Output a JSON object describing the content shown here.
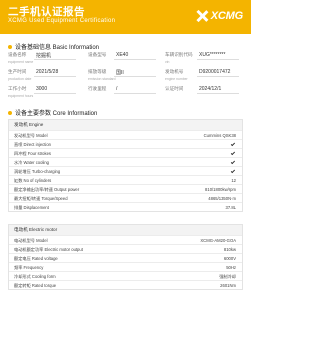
{
  "header": {
    "title_cn": "二手机认证报告",
    "title_en": "XCMG Used Equipment Certification",
    "logo": "XCMG"
  },
  "basic_info": {
    "section_title": "设备基础信息 Basic Information",
    "rows": [
      [
        {
          "label": "设备名称",
          "en": "equipment name",
          "value": "挖掘机"
        },
        {
          "label": "设备型号",
          "en": "",
          "value": "XE40"
        },
        {
          "label": "车辆识别代码",
          "en": "vin",
          "value": "XUG********"
        }
      ],
      [
        {
          "label": "生产时间",
          "en": "production date",
          "value": "2021/5/28"
        },
        {
          "label": "排放等级",
          "en": "emission standard",
          "value": "国II"
        },
        {
          "label": "发动机号",
          "en": "engine number",
          "value": "D9200017472"
        }
      ],
      [
        {
          "label": "工作小时",
          "en": "equipment hours",
          "value": "3000"
        },
        {
          "label": "行驶里程",
          "en": "",
          "value": "/"
        },
        {
          "label": "认证时间",
          "en": "",
          "value": "2024/12/1"
        }
      ]
    ]
  },
  "core_info": {
    "section_title": "设备主要参数 Core Information",
    "engine": {
      "head": "发动机 Engine",
      "rows": [
        {
          "label": "发动机型号 Model",
          "value": "Cummins QSK38",
          "check": false
        },
        {
          "label": "直喷 Direct injection",
          "value": "",
          "check": true
        },
        {
          "label": "四冲程 Four strokes",
          "value": "",
          "check": true
        },
        {
          "label": "水冷 Water cooling",
          "value": "",
          "check": true
        },
        {
          "label": "涡轮增压 Turbo-charging",
          "value": "",
          "check": true
        },
        {
          "label": "缸数 No of cylinders",
          "value": "12",
          "check": false
        },
        {
          "label": "额定净输出功率/转速 Output power",
          "value": "810/1800kw/rpm",
          "check": false
        },
        {
          "label": "最大扭矩/转速 Torque/Speed",
          "value": "4865/1350N·m",
          "check": false
        },
        {
          "label": "排量 Displacement",
          "value": "37.8L",
          "check": false
        }
      ]
    },
    "motor": {
      "head": "电动机 Electric motor",
      "rows": [
        {
          "label": "电动机型号 Model",
          "value": "XCMG-AM20-GOA",
          "check": false
        },
        {
          "label": "电动机额定功率 Electric motor output",
          "value": "810kw",
          "check": false
        },
        {
          "label": "额定电压 Rated voltage",
          "value": "6000V",
          "check": false
        },
        {
          "label": "频率 Frequency",
          "value": "50Hz",
          "check": false
        },
        {
          "label": "冷却形式 Cooling form",
          "value": "强制冷却",
          "check": false
        },
        {
          "label": "额定转矩 Rated torque",
          "value": "2601Nm",
          "check": false
        }
      ]
    }
  }
}
